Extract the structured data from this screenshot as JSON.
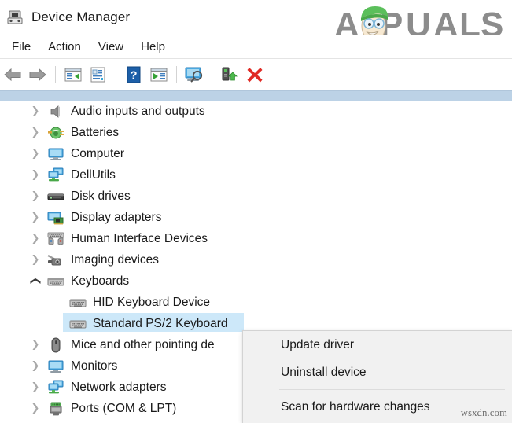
{
  "window": {
    "title": "Device Manager",
    "title_icon": "device-manager-icon"
  },
  "branding": {
    "logo_text": "APPUALS",
    "logo_color": "#8a8a8a",
    "hat_color": "#5bbf5b",
    "watermark": "wsxdn.com"
  },
  "menubar": {
    "items": [
      {
        "label": "File"
      },
      {
        "label": "Action"
      },
      {
        "label": "View"
      },
      {
        "label": "Help"
      }
    ]
  },
  "toolbar": {
    "buttons": [
      {
        "name": "back-button",
        "icon": "left-arrow-icon"
      },
      {
        "name": "forward-button",
        "icon": "right-arrow-icon"
      },
      {
        "name": "separator-1",
        "icon": "separator"
      },
      {
        "name": "show-hide-console-tree-button",
        "icon": "console-tree-icon"
      },
      {
        "name": "properties-button",
        "icon": "properties-icon"
      },
      {
        "name": "separator-2",
        "icon": "separator"
      },
      {
        "name": "help-button",
        "icon": "help-question-icon"
      },
      {
        "name": "show-hide-action-pane-button",
        "icon": "action-pane-icon"
      },
      {
        "name": "separator-3",
        "icon": "separator"
      },
      {
        "name": "scan-for-hardware-changes-button",
        "icon": "scan-monitor-icon"
      },
      {
        "name": "separator-4",
        "icon": "separator"
      },
      {
        "name": "update-driver-button",
        "icon": "update-driver-icon"
      },
      {
        "name": "uninstall-device-button",
        "icon": "red-x-icon"
      }
    ]
  },
  "tree": {
    "rows": [
      {
        "label": "Audio inputs and outputs",
        "icon": "speaker-icon",
        "state": "collapsed",
        "level": 0
      },
      {
        "label": "Batteries",
        "icon": "battery-icon",
        "state": "collapsed",
        "level": 0
      },
      {
        "label": "Computer",
        "icon": "monitor-icon",
        "state": "collapsed",
        "level": 0
      },
      {
        "label": "DellUtils",
        "icon": "network-stack-icon",
        "state": "collapsed",
        "level": 0
      },
      {
        "label": "Disk drives",
        "icon": "disk-drive-icon",
        "state": "collapsed",
        "level": 0
      },
      {
        "label": "Display adapters",
        "icon": "display-adapter-icon",
        "state": "collapsed",
        "level": 0
      },
      {
        "label": "Human Interface Devices",
        "icon": "hid-icon",
        "state": "collapsed",
        "level": 0
      },
      {
        "label": "Imaging devices",
        "icon": "camera-icon",
        "state": "collapsed",
        "level": 0
      },
      {
        "label": "Keyboards",
        "icon": "keyboard-icon",
        "state": "expanded",
        "level": 0
      },
      {
        "label": "HID Keyboard Device",
        "icon": "keyboard-icon",
        "state": "leaf",
        "level": 1
      },
      {
        "label": "Standard PS/2 Keyboard",
        "icon": "keyboard-icon",
        "state": "leaf",
        "level": 1,
        "selected": true
      },
      {
        "label": "Mice and other pointing de",
        "icon": "mouse-icon",
        "state": "collapsed",
        "level": 0
      },
      {
        "label": "Monitors",
        "icon": "monitor-icon",
        "state": "collapsed",
        "level": 0
      },
      {
        "label": "Network adapters",
        "icon": "network-stack-icon",
        "state": "collapsed",
        "level": 0
      },
      {
        "label": "Ports (COM & LPT)",
        "icon": "port-icon",
        "state": "collapsed",
        "level": 0
      }
    ],
    "selection_color": "#cde8f9"
  },
  "context_menu": {
    "items": [
      {
        "label": "Update driver",
        "type": "item"
      },
      {
        "label": "Uninstall device",
        "type": "item"
      },
      {
        "label": "",
        "type": "separator"
      },
      {
        "label": "Scan for hardware changes",
        "type": "item"
      }
    ]
  }
}
